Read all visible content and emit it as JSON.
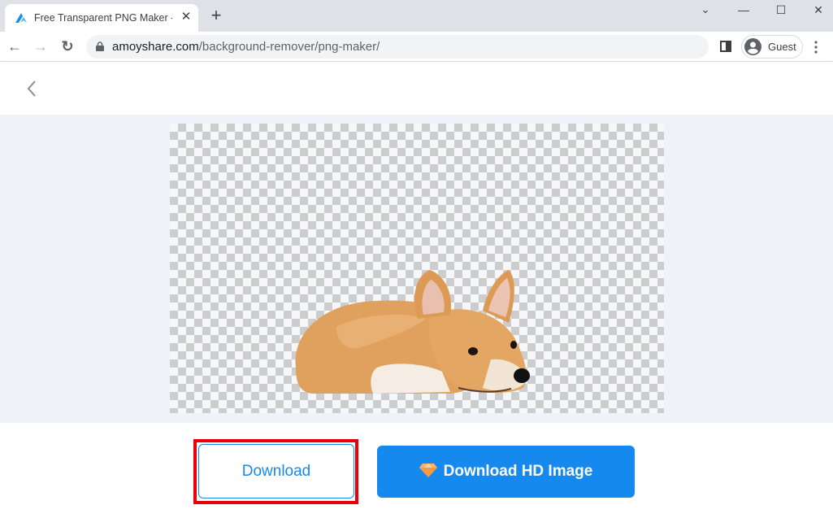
{
  "browser": {
    "tab": {
      "title": "Free Transparent PNG Maker - ",
      "close_glyph": "✕"
    },
    "new_tab_glyph": "+",
    "window_controls": {
      "tab_search": "⌄",
      "minimize": "—",
      "maximize": "☐",
      "close": "✕"
    },
    "nav": {
      "back": "←",
      "forward": "→",
      "reload": "↻"
    },
    "url": {
      "host": "amoyshare.com",
      "path": "/background-remover/png-maker/"
    },
    "profile_label": "Guest",
    "menu_glyph": "⋮"
  },
  "page": {
    "back_icon": "chevron-left",
    "image_alt": "Corgi dog with transparent background",
    "buttons": {
      "download": "Download",
      "download_hd": "Download HD Image"
    },
    "colors": {
      "accent": "#1589ee",
      "highlight": "#e8000b",
      "stage_bg": "#eff2f9"
    }
  }
}
